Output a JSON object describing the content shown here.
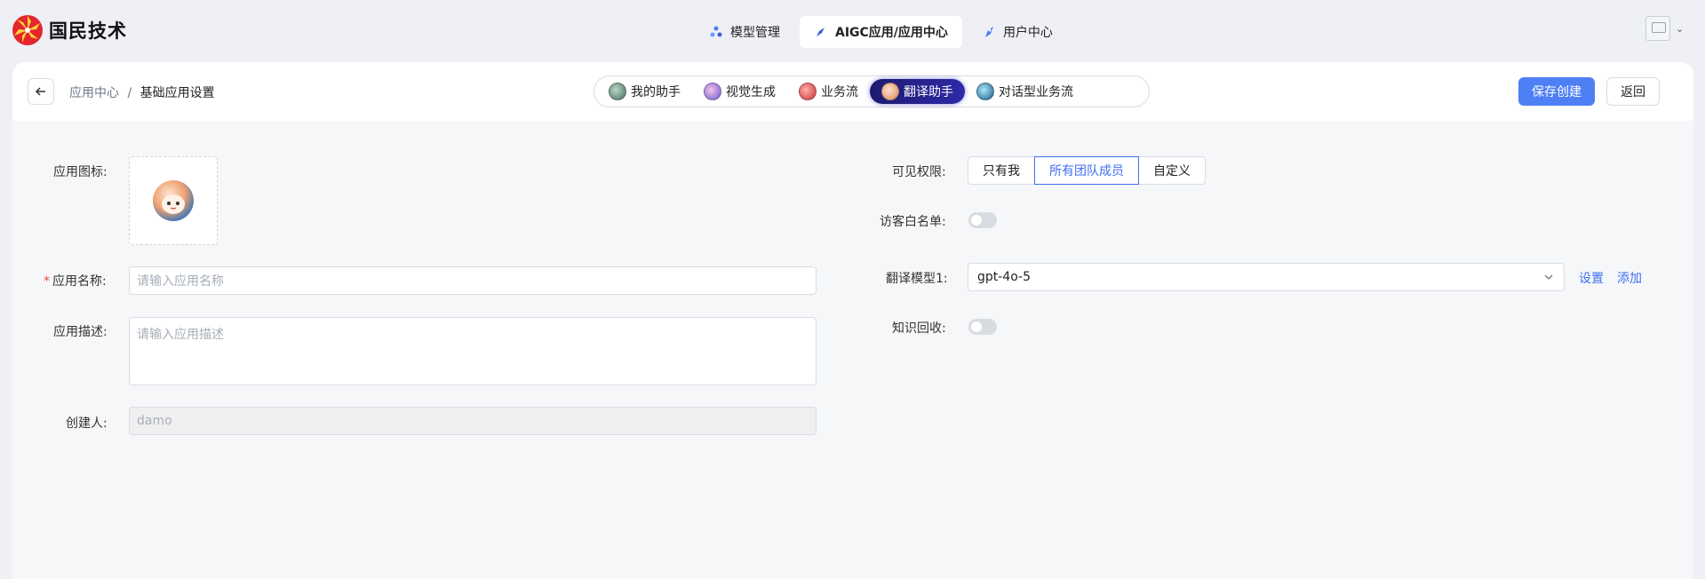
{
  "brand": {
    "name": "国民技术"
  },
  "nav": {
    "items": [
      {
        "label": "模型管理",
        "active": false
      },
      {
        "label": "AIGC应用/应用中心",
        "active": true
      },
      {
        "label": "用户中心",
        "active": false
      }
    ]
  },
  "breadcrumb": {
    "parent": "应用中心",
    "separator": "/",
    "current": "基础应用设置"
  },
  "tabs": [
    {
      "label": "我的助手",
      "active": false,
      "icon": "assistant-avatar-icon"
    },
    {
      "label": "视觉生成",
      "active": false,
      "icon": "vision-avatar-icon"
    },
    {
      "label": "业务流",
      "active": false,
      "icon": "workflow-avatar-icon"
    },
    {
      "label": "翻译助手",
      "active": true,
      "icon": "translator-avatar-icon"
    },
    {
      "label": "对话型业务流",
      "active": false,
      "icon": "chat-workflow-avatar-icon"
    }
  ],
  "actions": {
    "save_label": "保存创建",
    "return_label": "返回"
  },
  "form": {
    "app_icon_label": "应用图标:",
    "app_name_required_mark": "*",
    "app_name_label": "应用名称:",
    "app_name_placeholder": "请输入应用名称",
    "app_desc_label": "应用描述:",
    "app_desc_placeholder": "请输入应用描述",
    "creator_label": "创建人:",
    "creator_value": "damo",
    "visibility_label": "可见权限:",
    "visibility_options": [
      "只有我",
      "所有团队成员",
      "自定义"
    ],
    "visibility_selected": "所有团队成员",
    "guest_whitelist_label": "访客白名单:",
    "guest_whitelist_enabled": false,
    "translate_model_label": "翻译模型1:",
    "translate_model_value": "gpt-4o-5",
    "settings_link": "设置",
    "add_link": "添加",
    "knowledge_recall_label": "知识回收:",
    "knowledge_recall_enabled": false
  },
  "colors": {
    "primary": "#4e7ff5",
    "link": "#3f6ff2",
    "active_tab": "#2d2aa8",
    "required": "#e0493e"
  }
}
